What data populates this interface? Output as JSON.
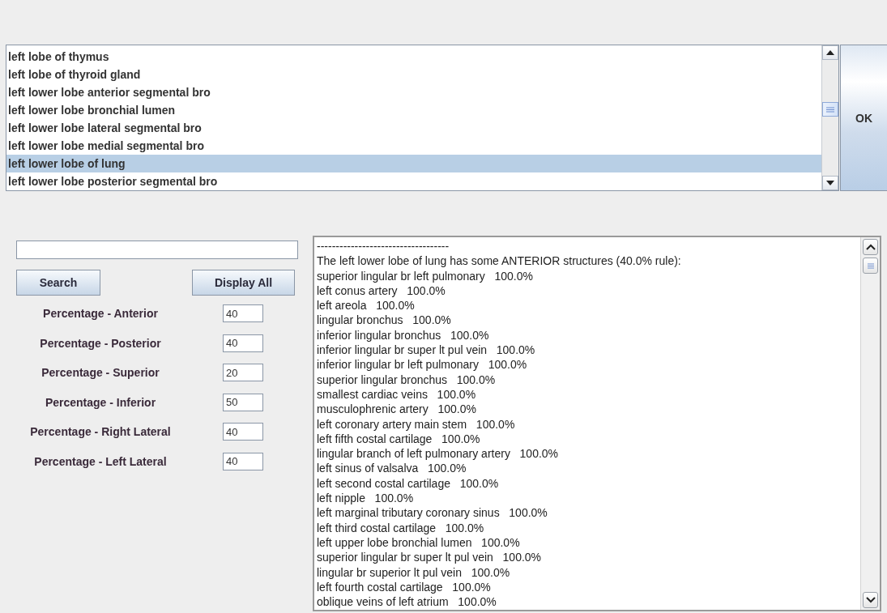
{
  "structure_list": {
    "items": [
      {
        "label": "left lobe of thymus",
        "selected": false
      },
      {
        "label": "left lobe of thyroid gland",
        "selected": false
      },
      {
        "label": "left lower lobe anterior segmental bro",
        "selected": false
      },
      {
        "label": "left lower lobe bronchial lumen",
        "selected": false
      },
      {
        "label": "left lower lobe lateral segmental bro",
        "selected": false
      },
      {
        "label": "left lower lobe medial segmental bro",
        "selected": false
      },
      {
        "label": "left lower lobe of lung",
        "selected": true
      },
      {
        "label": "left lower lobe posterior segmental bro",
        "selected": false
      }
    ]
  },
  "ok_button": "OK",
  "search_button": "Search",
  "display_all_button": "Display All",
  "percentages": [
    {
      "label": "Percentage - Anterior",
      "value": "40"
    },
    {
      "label": "Percentage - Posterior",
      "value": "40"
    },
    {
      "label": "Percentage - Superior",
      "value": "20"
    },
    {
      "label": "Percentage - Inferior",
      "value": "50"
    },
    {
      "label": "Percentage - Right Lateral",
      "value": "40"
    },
    {
      "label": "Percentage - Left Lateral",
      "value": "40"
    }
  ],
  "results": {
    "lines": [
      "-----------------------------------",
      "The left lower lobe of lung has some ANTERIOR structures (40.0% rule):",
      "superior lingular br left pulmonary   100.0%",
      "left conus artery   100.0%",
      "left areola   100.0%",
      "lingular bronchus   100.0%",
      "inferior lingular bronchus   100.0%",
      "inferior lingular br super lt pul vein   100.0%",
      "inferior lingular br left pulmonary   100.0%",
      "superior lingular bronchus   100.0%",
      "smallest cardiac veins   100.0%",
      "musculophrenic artery   100.0%",
      "left coronary artery main stem   100.0%",
      "left fifth costal cartilage   100.0%",
      "lingular branch of left pulmonary artery   100.0%",
      "left sinus of valsalva   100.0%",
      "left second costal cartilage   100.0%",
      "left nipple   100.0%",
      "left marginal tributary coronary sinus   100.0%",
      "left third costal cartilage   100.0%",
      "left upper lobe bronchial lumen   100.0%",
      "superior lingular br super lt pul vein   100.0%",
      "lingular br superior lt pul vein   100.0%",
      "left fourth costal cartilage   100.0%",
      "oblique veins of left atrium   100.0%"
    ]
  }
}
